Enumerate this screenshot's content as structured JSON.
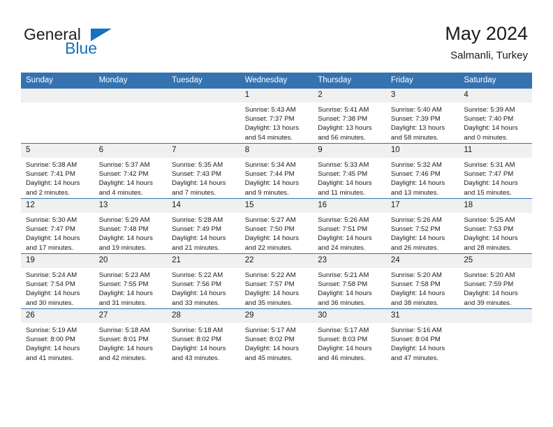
{
  "logo": {
    "line1": "General",
    "line2": "Blue",
    "flag_icon": "triangle-flag-icon",
    "accent_color": "#1272c0"
  },
  "header": {
    "month_title": "May 2024",
    "location": "Salmanli, Turkey"
  },
  "theme": {
    "header_bg": "#3572b0",
    "daynum_bg": "#f0f0f0",
    "text": "#1a1a1a"
  },
  "columns": [
    "Sunday",
    "Monday",
    "Tuesday",
    "Wednesday",
    "Thursday",
    "Friday",
    "Saturday"
  ],
  "weeks": [
    [
      {
        "day": "",
        "empty": true
      },
      {
        "day": "",
        "empty": true
      },
      {
        "day": "",
        "empty": true
      },
      {
        "day": "1",
        "sunrise": "Sunrise: 5:43 AM",
        "sunset": "Sunset: 7:37 PM",
        "daylight1": "Daylight: 13 hours",
        "daylight2": "and 54 minutes."
      },
      {
        "day": "2",
        "sunrise": "Sunrise: 5:41 AM",
        "sunset": "Sunset: 7:38 PM",
        "daylight1": "Daylight: 13 hours",
        "daylight2": "and 56 minutes."
      },
      {
        "day": "3",
        "sunrise": "Sunrise: 5:40 AM",
        "sunset": "Sunset: 7:39 PM",
        "daylight1": "Daylight: 13 hours",
        "daylight2": "and 58 minutes."
      },
      {
        "day": "4",
        "sunrise": "Sunrise: 5:39 AM",
        "sunset": "Sunset: 7:40 PM",
        "daylight1": "Daylight: 14 hours",
        "daylight2": "and 0 minutes."
      }
    ],
    [
      {
        "day": "5",
        "sunrise": "Sunrise: 5:38 AM",
        "sunset": "Sunset: 7:41 PM",
        "daylight1": "Daylight: 14 hours",
        "daylight2": "and 2 minutes."
      },
      {
        "day": "6",
        "sunrise": "Sunrise: 5:37 AM",
        "sunset": "Sunset: 7:42 PM",
        "daylight1": "Daylight: 14 hours",
        "daylight2": "and 4 minutes."
      },
      {
        "day": "7",
        "sunrise": "Sunrise: 5:35 AM",
        "sunset": "Sunset: 7:43 PM",
        "daylight1": "Daylight: 14 hours",
        "daylight2": "and 7 minutes."
      },
      {
        "day": "8",
        "sunrise": "Sunrise: 5:34 AM",
        "sunset": "Sunset: 7:44 PM",
        "daylight1": "Daylight: 14 hours",
        "daylight2": "and 9 minutes."
      },
      {
        "day": "9",
        "sunrise": "Sunrise: 5:33 AM",
        "sunset": "Sunset: 7:45 PM",
        "daylight1": "Daylight: 14 hours",
        "daylight2": "and 11 minutes."
      },
      {
        "day": "10",
        "sunrise": "Sunrise: 5:32 AM",
        "sunset": "Sunset: 7:46 PM",
        "daylight1": "Daylight: 14 hours",
        "daylight2": "and 13 minutes."
      },
      {
        "day": "11",
        "sunrise": "Sunrise: 5:31 AM",
        "sunset": "Sunset: 7:47 PM",
        "daylight1": "Daylight: 14 hours",
        "daylight2": "and 15 minutes."
      }
    ],
    [
      {
        "day": "12",
        "sunrise": "Sunrise: 5:30 AM",
        "sunset": "Sunset: 7:47 PM",
        "daylight1": "Daylight: 14 hours",
        "daylight2": "and 17 minutes."
      },
      {
        "day": "13",
        "sunrise": "Sunrise: 5:29 AM",
        "sunset": "Sunset: 7:48 PM",
        "daylight1": "Daylight: 14 hours",
        "daylight2": "and 19 minutes."
      },
      {
        "day": "14",
        "sunrise": "Sunrise: 5:28 AM",
        "sunset": "Sunset: 7:49 PM",
        "daylight1": "Daylight: 14 hours",
        "daylight2": "and 21 minutes."
      },
      {
        "day": "15",
        "sunrise": "Sunrise: 5:27 AM",
        "sunset": "Sunset: 7:50 PM",
        "daylight1": "Daylight: 14 hours",
        "daylight2": "and 22 minutes."
      },
      {
        "day": "16",
        "sunrise": "Sunrise: 5:26 AM",
        "sunset": "Sunset: 7:51 PM",
        "daylight1": "Daylight: 14 hours",
        "daylight2": "and 24 minutes."
      },
      {
        "day": "17",
        "sunrise": "Sunrise: 5:26 AM",
        "sunset": "Sunset: 7:52 PM",
        "daylight1": "Daylight: 14 hours",
        "daylight2": "and 26 minutes."
      },
      {
        "day": "18",
        "sunrise": "Sunrise: 5:25 AM",
        "sunset": "Sunset: 7:53 PM",
        "daylight1": "Daylight: 14 hours",
        "daylight2": "and 28 minutes."
      }
    ],
    [
      {
        "day": "19",
        "sunrise": "Sunrise: 5:24 AM",
        "sunset": "Sunset: 7:54 PM",
        "daylight1": "Daylight: 14 hours",
        "daylight2": "and 30 minutes."
      },
      {
        "day": "20",
        "sunrise": "Sunrise: 5:23 AM",
        "sunset": "Sunset: 7:55 PM",
        "daylight1": "Daylight: 14 hours",
        "daylight2": "and 31 minutes."
      },
      {
        "day": "21",
        "sunrise": "Sunrise: 5:22 AM",
        "sunset": "Sunset: 7:56 PM",
        "daylight1": "Daylight: 14 hours",
        "daylight2": "and 33 minutes."
      },
      {
        "day": "22",
        "sunrise": "Sunrise: 5:22 AM",
        "sunset": "Sunset: 7:57 PM",
        "daylight1": "Daylight: 14 hours",
        "daylight2": "and 35 minutes."
      },
      {
        "day": "23",
        "sunrise": "Sunrise: 5:21 AM",
        "sunset": "Sunset: 7:58 PM",
        "daylight1": "Daylight: 14 hours",
        "daylight2": "and 36 minutes."
      },
      {
        "day": "24",
        "sunrise": "Sunrise: 5:20 AM",
        "sunset": "Sunset: 7:58 PM",
        "daylight1": "Daylight: 14 hours",
        "daylight2": "and 38 minutes."
      },
      {
        "day": "25",
        "sunrise": "Sunrise: 5:20 AM",
        "sunset": "Sunset: 7:59 PM",
        "daylight1": "Daylight: 14 hours",
        "daylight2": "and 39 minutes."
      }
    ],
    [
      {
        "day": "26",
        "sunrise": "Sunrise: 5:19 AM",
        "sunset": "Sunset: 8:00 PM",
        "daylight1": "Daylight: 14 hours",
        "daylight2": "and 41 minutes."
      },
      {
        "day": "27",
        "sunrise": "Sunrise: 5:18 AM",
        "sunset": "Sunset: 8:01 PM",
        "daylight1": "Daylight: 14 hours",
        "daylight2": "and 42 minutes."
      },
      {
        "day": "28",
        "sunrise": "Sunrise: 5:18 AM",
        "sunset": "Sunset: 8:02 PM",
        "daylight1": "Daylight: 14 hours",
        "daylight2": "and 43 minutes."
      },
      {
        "day": "29",
        "sunrise": "Sunrise: 5:17 AM",
        "sunset": "Sunset: 8:02 PM",
        "daylight1": "Daylight: 14 hours",
        "daylight2": "and 45 minutes."
      },
      {
        "day": "30",
        "sunrise": "Sunrise: 5:17 AM",
        "sunset": "Sunset: 8:03 PM",
        "daylight1": "Daylight: 14 hours",
        "daylight2": "and 46 minutes."
      },
      {
        "day": "31",
        "sunrise": "Sunrise: 5:16 AM",
        "sunset": "Sunset: 8:04 PM",
        "daylight1": "Daylight: 14 hours",
        "daylight2": "and 47 minutes."
      },
      {
        "day": "",
        "empty": true
      }
    ]
  ]
}
